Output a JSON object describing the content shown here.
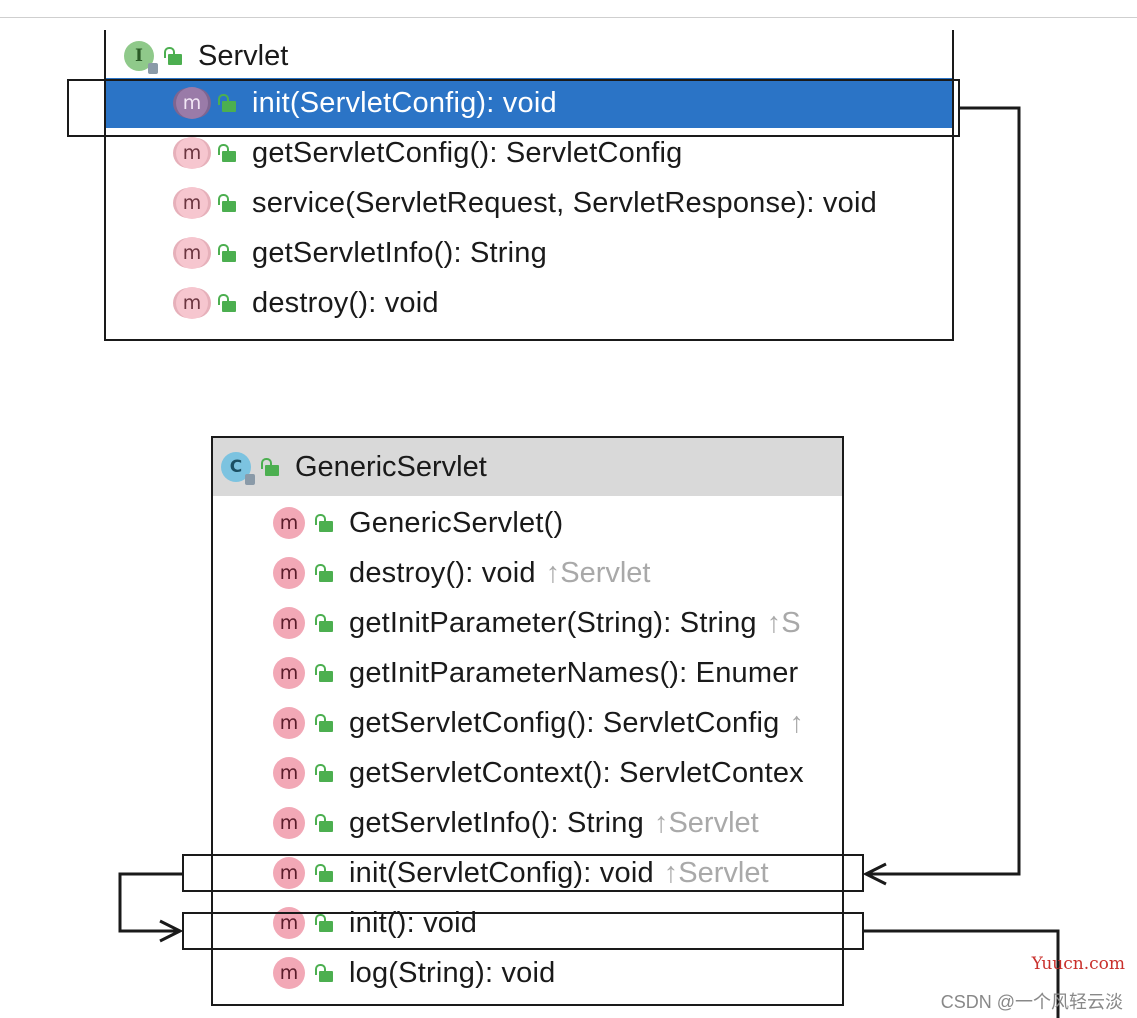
{
  "servlet": {
    "icon": "interface-icon",
    "icon_letter": "I",
    "title": "Servlet",
    "methods": [
      {
        "sig": "init(ServletConfig): void",
        "selected": true
      },
      {
        "sig": "getServletConfig(): ServletConfig"
      },
      {
        "sig": "service(ServletRequest, ServletResponse): void"
      },
      {
        "sig": "getServletInfo(): String"
      },
      {
        "sig": "destroy(): void"
      }
    ]
  },
  "generic": {
    "icon": "class-icon",
    "icon_letter": "C",
    "title": "GenericServlet",
    "methods": [
      {
        "sig": "GenericServlet()",
        "hint": ""
      },
      {
        "sig": "destroy(): void",
        "hint": "↑Servlet"
      },
      {
        "sig": "getInitParameter(String): String",
        "hint": "↑S"
      },
      {
        "sig": "getInitParameterNames(): Enumer",
        "hint": ""
      },
      {
        "sig": "getServletConfig(): ServletConfig",
        "hint": "↑"
      },
      {
        "sig": "getServletContext(): ServletContex",
        "hint": ""
      },
      {
        "sig": "getServletInfo(): String",
        "hint": "↑Servlet"
      },
      {
        "sig": "init(ServletConfig): void",
        "hint": "↑Servlet"
      },
      {
        "sig": "init(): void",
        "hint": ""
      },
      {
        "sig": "log(String): void",
        "hint": ""
      }
    ]
  },
  "method_icon_letter": "m",
  "watermark": {
    "site": "Yuucn.com",
    "author": "CSDN @一个风轻云淡"
  },
  "colors": {
    "selection": "#2b74c6",
    "method_icon": "#f2a8b6",
    "lock": "#4caf50",
    "hint": "#a9a9a9"
  }
}
